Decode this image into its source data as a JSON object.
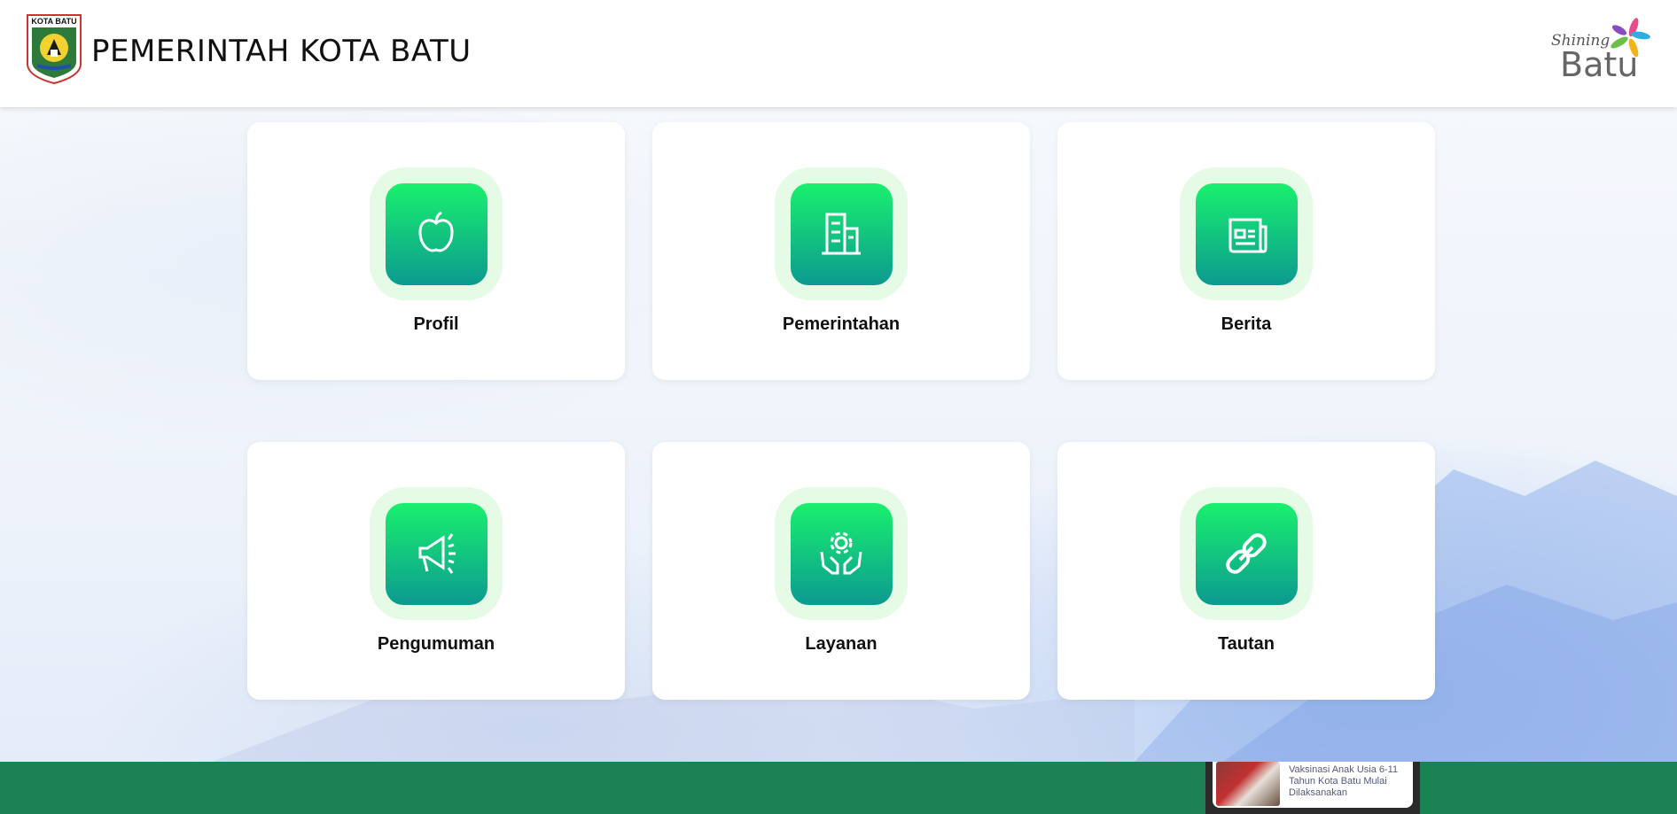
{
  "header": {
    "emblem_text": "KOTA BATU",
    "title": "PEMERINTAH KOTA BATU",
    "brand_small": "Shining",
    "brand_large": "Batu"
  },
  "menu": [
    {
      "label": "Profil",
      "icon": "apple-icon"
    },
    {
      "label": "Pemerintahan",
      "icon": "building-icon"
    },
    {
      "label": "Berita",
      "icon": "newspaper-icon"
    },
    {
      "label": "Pengumuman",
      "icon": "megaphone-icon"
    },
    {
      "label": "Layanan",
      "icon": "hands-gear-icon"
    },
    {
      "label": "Tautan",
      "icon": "link-icon"
    }
  ],
  "news_ticker": {
    "title": "Vaksinasi Anak Usia 6-11 Tahun Kota Batu Mulai Dilaksanakan"
  },
  "colors": {
    "accent_green": "#19f06e",
    "accent_teal": "#0c9a90",
    "footer": "#1a8254"
  }
}
